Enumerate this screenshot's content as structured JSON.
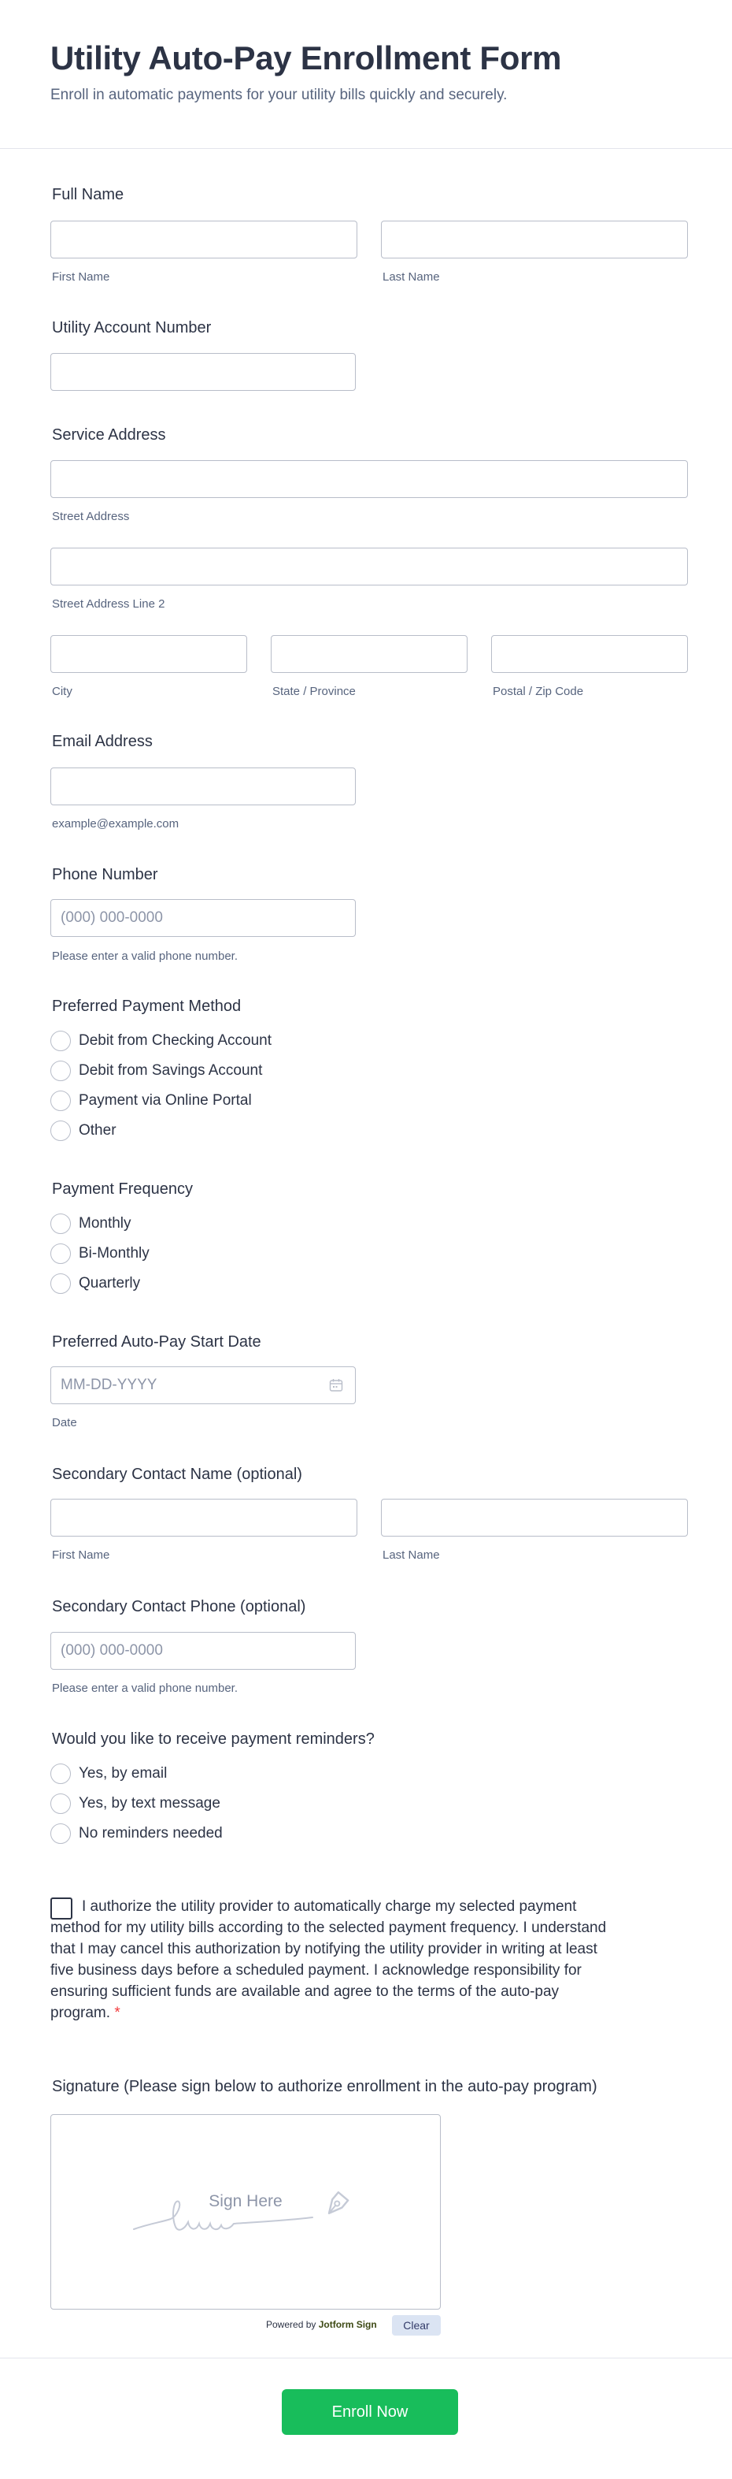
{
  "form": {
    "title": "Utility Auto-Pay Enrollment Form",
    "subtitle": "Enroll in automatic payments for your utility bills quickly and securely."
  },
  "full_name": {
    "label": "Full Name",
    "first_sub": "First Name",
    "last_sub": "Last Name"
  },
  "account_number": {
    "label": "Utility Account Number"
  },
  "service_address": {
    "label": "Service Address",
    "street_sub": "Street Address",
    "street2_sub": "Street Address Line 2",
    "city_sub": "City",
    "state_sub": "State / Province",
    "zip_sub": "Postal / Zip Code"
  },
  "email": {
    "label": "Email Address",
    "sub": "example@example.com"
  },
  "phone": {
    "label": "Phone Number",
    "placeholder": "(000) 000-0000",
    "sub": "Please enter a valid phone number."
  },
  "payment_method": {
    "label": "Preferred Payment Method",
    "options": [
      "Debit from Checking Account",
      "Debit from Savings Account",
      "Payment via Online Portal",
      "Other"
    ]
  },
  "payment_frequency": {
    "label": "Payment Frequency",
    "options": [
      "Monthly",
      "Bi-Monthly",
      "Quarterly"
    ]
  },
  "start_date": {
    "label": "Preferred Auto-Pay Start Date",
    "placeholder": "MM-DD-YYYY",
    "sub": "Date",
    "icon": "calendar-icon"
  },
  "secondary_name": {
    "label": "Secondary Contact Name (optional)",
    "first_sub": "First Name",
    "last_sub": "Last Name"
  },
  "secondary_phone": {
    "label": "Secondary Contact Phone (optional)",
    "placeholder": "(000) 000-0000",
    "sub": "Please enter a valid phone number."
  },
  "reminders": {
    "label": "Would you like to receive payment reminders?",
    "options": [
      "Yes, by email",
      "Yes, by text message",
      "No reminders needed"
    ]
  },
  "consent": {
    "text": "I authorize the utility provider to automatically charge my selected payment method for my utility bills according to the selected payment frequency. I understand that I may cancel this authorization by notifying the utility provider in writing at least five business days before a scheduled payment. I acknowledge responsibility for ensuring sufficient funds are available and agree to the terms of the auto-pay program.",
    "required_mark": "*"
  },
  "signature": {
    "label": "Signature (Please sign below to authorize enrollment in the auto-pay program)",
    "placeholder": "Sign Here",
    "powered_prefix": "Powered by",
    "powered_brand": "Jotform Sign",
    "clear_label": "Clear",
    "icon": "pen-nib-icon"
  },
  "submit": {
    "label": "Enroll Now"
  },
  "colors": {
    "accent": "#18bd5b",
    "text": "#2c3345",
    "muted": "#57647e",
    "border": "#b8bdc9",
    "required": "#f23a3c"
  }
}
